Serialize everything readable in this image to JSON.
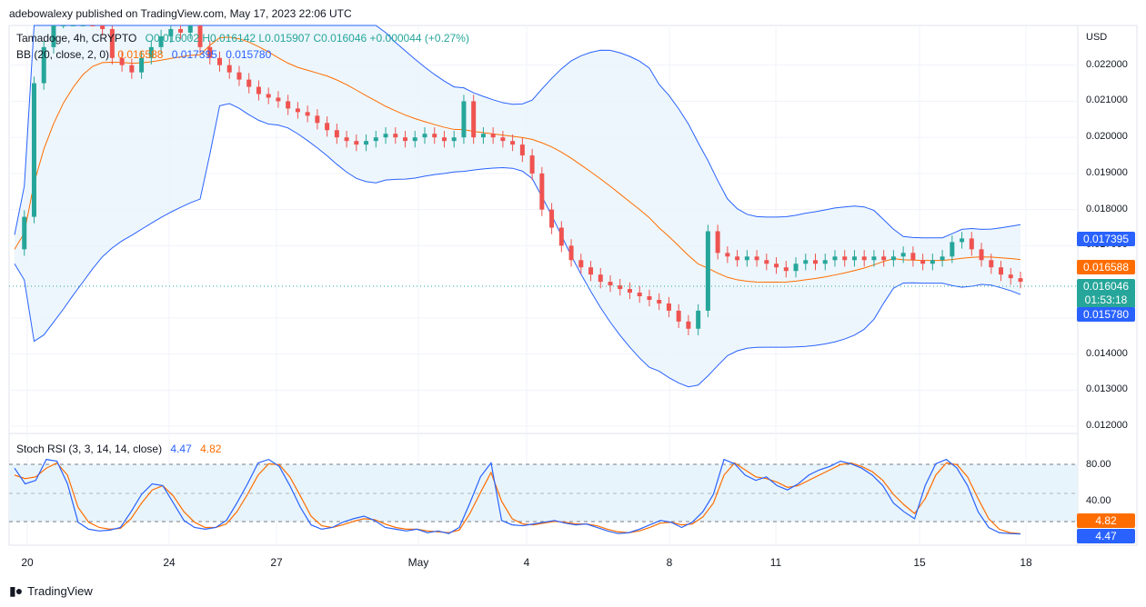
{
  "header": {
    "published_by": "adebowalexy published on TradingView.com, May 17, 2023 22:06 UTC"
  },
  "legend": {
    "symbol": "Tamadoge, 4h, CRYPTO",
    "ohlc": "O0.016002 H0.016142 L0.015907 C0.016046 +0.000044 (+0.27%)",
    "bb_title": "BB (20, close, 2, 0)",
    "bb_basis": "0.016588",
    "bb_upper": "0.017395",
    "bb_lower": "0.015780",
    "rsi_title": "Stoch RSI (3, 3, 14, 14, close)",
    "rsi_k": "4.47",
    "rsi_d": "4.82"
  },
  "axis": {
    "currency": "USD",
    "price_ticks": [
      "0.022000",
      "0.021000",
      "0.020000",
      "0.019000",
      "0.018000",
      "0.017000",
      "0.015000",
      "0.014000",
      "0.013000",
      "0.012000"
    ],
    "rsi_ticks": [
      "80.00",
      "40.00"
    ],
    "x_ticks": [
      "20",
      "24",
      "27",
      "May",
      "4",
      "8",
      "11",
      "15",
      "18"
    ]
  },
  "price_tags": {
    "upper": "0.017395",
    "basis": "0.016588",
    "last_price": "0.016046",
    "countdown": "01:53:18",
    "lower": "0.015780",
    "rsi_d": "4.82",
    "rsi_k": "4.47"
  },
  "footer": {
    "brand": "TradingView"
  },
  "colors": {
    "up": "#26a69a",
    "down": "#ef5350",
    "bb_band": "#2962ff",
    "bb_basis": "#ff6d00",
    "band_fill": "#e8f4fb",
    "rsi_k": "#2962ff",
    "rsi_d": "#ff6d00"
  },
  "chart_data": [
    {
      "type": "candlestick",
      "title": "Tamadoge, 4h, CRYPTO",
      "ylabel": "USD",
      "ylim": [
        0.0118,
        0.0231
      ],
      "close_series": [
        0.0169,
        0.0178,
        0.0215,
        0.0225,
        0.0232,
        0.0238,
        0.024,
        0.0242,
        0.0238,
        0.023,
        0.0222,
        0.022,
        0.0218,
        0.0222,
        0.0225,
        0.0228,
        0.023,
        0.0229,
        0.0231,
        0.0225,
        0.0222,
        0.022,
        0.0218,
        0.0216,
        0.0214,
        0.0212,
        0.0211,
        0.021,
        0.0208,
        0.0207,
        0.0206,
        0.0204,
        0.0202,
        0.02,
        0.0199,
        0.0198,
        0.0199,
        0.02,
        0.0201,
        0.02,
        0.0199,
        0.02,
        0.0201,
        0.02,
        0.0199,
        0.02,
        0.021,
        0.02,
        0.0201,
        0.02,
        0.0199,
        0.0198,
        0.0195,
        0.019,
        0.018,
        0.0175,
        0.017,
        0.0166,
        0.0164,
        0.0162,
        0.016,
        0.0159,
        0.0158,
        0.0157,
        0.0156,
        0.0155,
        0.0154,
        0.0152,
        0.0149,
        0.0147,
        0.0152,
        0.0174,
        0.0168,
        0.0167,
        0.0166,
        0.0167,
        0.0166,
        0.0165,
        0.0164,
        0.0163,
        0.0165,
        0.0166,
        0.0165,
        0.0166,
        0.0167,
        0.0166,
        0.0167,
        0.0166,
        0.0167,
        0.0166,
        0.0167,
        0.0168,
        0.0166,
        0.0165,
        0.0166,
        0.0167,
        0.0171,
        0.0172,
        0.0169,
        0.0166,
        0.0164,
        0.0162,
        0.0161,
        0.016
      ],
      "bb_upper_end": 0.017395,
      "bb_basis_end": 0.016588,
      "bb_lower_end": 0.01578,
      "last": 0.016046
    },
    {
      "type": "line",
      "title": "Stoch RSI (3, 3, 14, 14, close)",
      "ylim": [
        0,
        100
      ],
      "k": [
        80,
        62,
        66,
        90,
        88,
        62,
        18,
        10,
        8,
        9,
        12,
        30,
        50,
        62,
        60,
        40,
        20,
        12,
        10,
        12,
        20,
        40,
        62,
        86,
        90,
        82,
        60,
        35,
        15,
        10,
        12,
        18,
        22,
        25,
        20,
        12,
        10,
        8,
        10,
        6,
        8,
        5,
        12,
        40,
        70,
        86,
        20,
        15,
        14,
        16,
        18,
        20,
        17,
        15,
        16,
        12,
        8,
        5,
        6,
        10,
        15,
        20,
        18,
        12,
        18,
        30,
        50,
        90,
        85,
        72,
        66,
        70,
        60,
        55,
        62,
        72,
        78,
        82,
        88,
        85,
        80,
        72,
        60,
        40,
        30,
        22,
        60,
        85,
        90,
        80,
        60,
        30,
        12,
        6,
        5,
        4.47
      ],
      "d": [
        72,
        68,
        70,
        80,
        86,
        72,
        35,
        18,
        12,
        10,
        11,
        22,
        40,
        55,
        60,
        48,
        30,
        18,
        12,
        12,
        16,
        30,
        50,
        72,
        85,
        84,
        70,
        48,
        25,
        14,
        12,
        15,
        19,
        22,
        21,
        16,
        12,
        10,
        10,
        8,
        7,
        6,
        9,
        28,
        52,
        75,
        42,
        22,
        16,
        15,
        17,
        19,
        18,
        16,
        16,
        14,
        10,
        7,
        6,
        8,
        12,
        17,
        18,
        15,
        16,
        24,
        40,
        72,
        86,
        78,
        70,
        68,
        64,
        58,
        60,
        66,
        72,
        78,
        84,
        86,
        82,
        76,
        66,
        50,
        38,
        28,
        45,
        72,
        86,
        84,
        70,
        45,
        22,
        10,
        6,
        4.82
      ]
    }
  ]
}
